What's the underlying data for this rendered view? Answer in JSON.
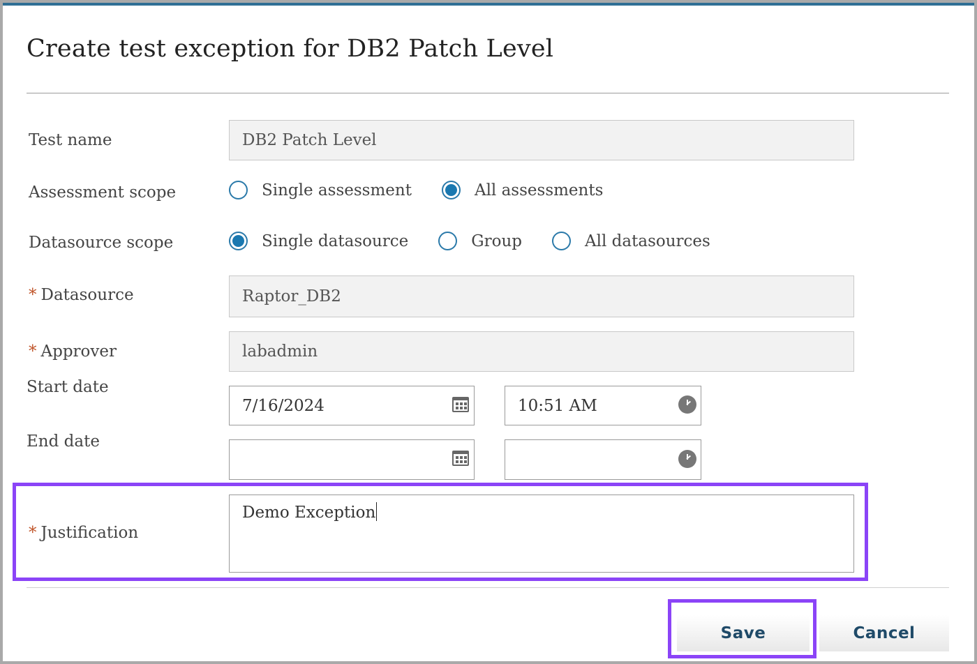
{
  "dialog": {
    "title": "Create test exception for DB2 Patch Level"
  },
  "form": {
    "test_name": {
      "label": "Test name",
      "value": "DB2 Patch Level"
    },
    "assessment_scope": {
      "label": "Assessment scope",
      "options": [
        {
          "label": "Single assessment",
          "checked": false
        },
        {
          "label": "All assessments",
          "checked": true
        }
      ]
    },
    "datasource_scope": {
      "label": "Datasource scope",
      "options": [
        {
          "label": "Single datasource",
          "checked": true
        },
        {
          "label": "Group",
          "checked": false
        },
        {
          "label": "All datasources",
          "checked": false
        }
      ]
    },
    "datasource": {
      "required_mark": "*",
      "label": "Datasource",
      "value": "Raptor_DB2"
    },
    "approver": {
      "required_mark": "*",
      "label": "Approver",
      "value": "labadmin"
    },
    "start_date": {
      "label": "Start date",
      "date": "7/16/2024",
      "time": "10:51 AM"
    },
    "end_date": {
      "label": "End date",
      "date": "",
      "time": ""
    },
    "justification": {
      "required_mark": "*",
      "label": "Justification",
      "value": "Demo Exception"
    }
  },
  "buttons": {
    "save": "Save",
    "cancel": "Cancel"
  },
  "icons": {
    "calendar": "calendar-icon",
    "clock": "clock-icon"
  },
  "colors": {
    "accent": "#2f6f95",
    "radio": "#1a78b0",
    "required": "#c0552a",
    "highlight": "#8b44f7"
  }
}
